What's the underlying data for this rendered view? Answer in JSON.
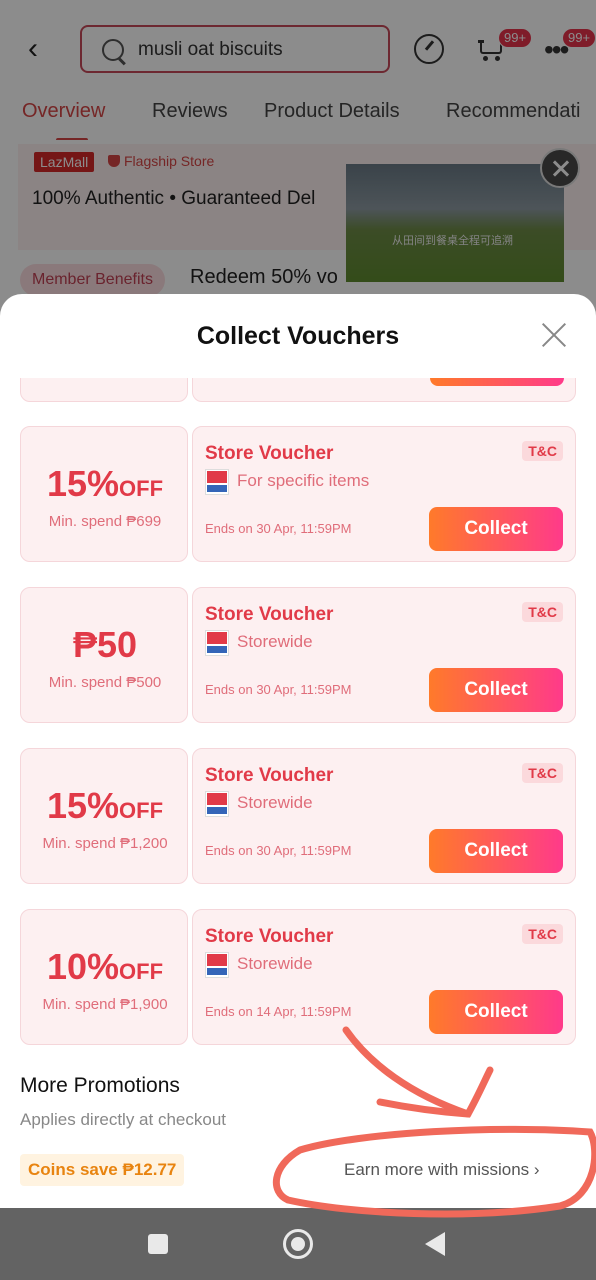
{
  "search": {
    "value": "musli oat biscuits"
  },
  "badges": {
    "cart": "99+",
    "more": "99+"
  },
  "tabs": [
    {
      "label": "Overview"
    },
    {
      "label": "Reviews"
    },
    {
      "label": "Product Details"
    },
    {
      "label": "Recommendati"
    }
  ],
  "store": {
    "lazmall": "LazMall",
    "flagship": "Flagship Store",
    "assurance": "100% Authentic • Guaranteed Del",
    "member": "Member Benefits",
    "redeem": "Redeem 50% vo"
  },
  "video": {
    "caption": "从田间到餐桌全程可追溯"
  },
  "sheet": {
    "title": "Collect Vouchers"
  },
  "vouchers": [
    {
      "amount": "15%",
      "suffix": "OFF",
      "min": "Min. spend ₱699",
      "title": "Store Voucher",
      "scope": "For specific items",
      "ends": "Ends on 30 Apr, 11:59PM",
      "tc": "T&C",
      "button": "Collect"
    },
    {
      "amount": "₱50",
      "suffix": "",
      "min": "Min. spend ₱500",
      "title": "Store Voucher",
      "scope": "Storewide",
      "ends": "Ends on 30 Apr, 11:59PM",
      "tc": "T&C",
      "button": "Collect"
    },
    {
      "amount": "15%",
      "suffix": "OFF",
      "min": "Min. spend ₱1,200",
      "title": "Store Voucher",
      "scope": "Storewide",
      "ends": "Ends on 30 Apr, 11:59PM",
      "tc": "T&C",
      "button": "Collect"
    },
    {
      "amount": "10%",
      "suffix": "OFF",
      "min": "Min. spend ₱1,900",
      "title": "Store Voucher",
      "scope": "Storewide",
      "ends": "Ends on 14 Apr, 11:59PM",
      "tc": "T&C",
      "button": "Collect"
    }
  ],
  "promotions": {
    "title": "More Promotions",
    "subtitle": "Applies directly at checkout",
    "coins": "Coins save ₱12.77",
    "missions": "Earn more with missions ›"
  },
  "colors": {
    "accent": "#e13a48",
    "button_start": "#ff7a2a",
    "button_end": "#ff3a8a",
    "annotation": "#f0695a"
  }
}
